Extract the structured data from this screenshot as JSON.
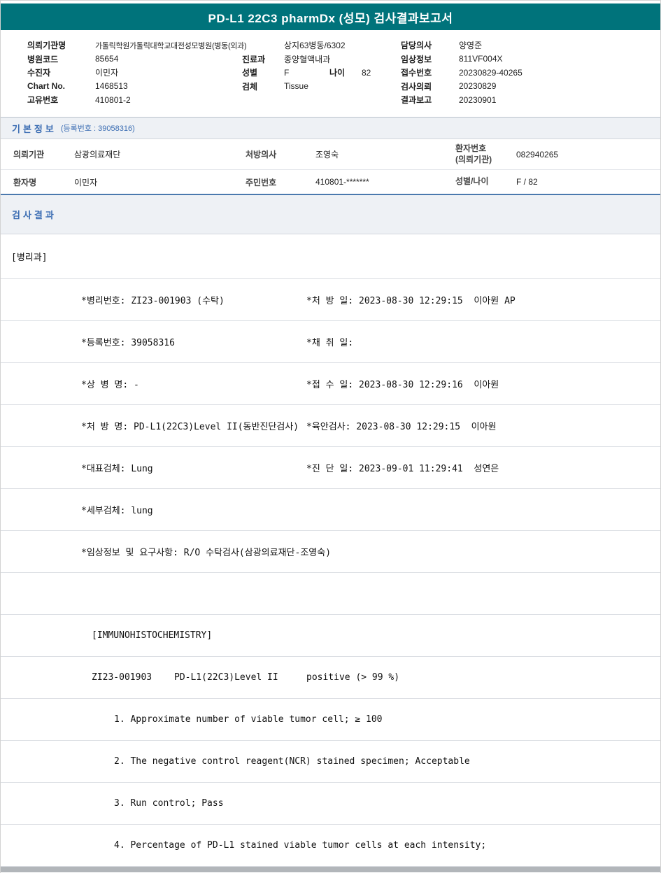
{
  "title": "PD-L1 22C3 pharmDx (성모) 검사결과보고서",
  "colors": {
    "header_teal": "#00737B",
    "section_blue": "#3B6DB3",
    "divider_blue": "#4B79AE"
  },
  "patient_header": {
    "rows": [
      {
        "a_label": "의뢰기관명",
        "a_value": "가톨릭학원가톨릭대학교대전성모병원(병동(외과)",
        "b_label": "",
        "b_value": "상지63병동/6302",
        "b2_label": "",
        "b2_value": "",
        "c_label": "담당의사",
        "c_value": "양영준"
      },
      {
        "a_label": "병원코드",
        "a_value": "85654",
        "b_label": "진료과",
        "b_value": "종양혈액내과",
        "b2_label": "",
        "b2_value": "",
        "c_label": "임상정보",
        "c_value": "811VF004X"
      },
      {
        "a_label": "수진자",
        "a_value": "이민자",
        "b_label": "성별",
        "b_value": "F",
        "b2_label": "나이",
        "b2_value": "82",
        "c_label": "접수번호",
        "c_value": "20230829-40265"
      },
      {
        "a_label": "Chart No.",
        "a_value": "1468513",
        "b_label": "검체",
        "b_value": "Tissue",
        "b2_label": "",
        "b2_value": "",
        "c_label": "검사의뢰",
        "c_value": "20230829"
      },
      {
        "a_label": "고유번호",
        "a_value": "410801-2",
        "b_label": "",
        "b_value": "",
        "b2_label": "",
        "b2_value": "",
        "c_label": "결과보고",
        "c_value": "20230901"
      }
    ]
  },
  "basic_info": {
    "title": "기본정보",
    "subtitle": "(등록번호 : 39058316)",
    "row1": {
      "l1": "의뢰기관",
      "v1": "삼광의료재단",
      "l2": "처방의사",
      "v2": "조영숙",
      "l3a": "환자번호",
      "l3b": "(의뢰기관)",
      "v3": "082940265"
    },
    "row2": {
      "l1": "환자명",
      "v1": "이민자",
      "l2": "주민번호",
      "v2": "410801-*******",
      "l3": "성별/나이",
      "v3": "F / 82"
    }
  },
  "results": {
    "title": "검사결과",
    "department": "[병리과]",
    "lines": [
      {
        "left": "*병리번호: ZI23-001903 (수탁)",
        "right": "*처 방 일: 2023-08-30 12:29:15  이아원 AP"
      },
      {
        "left": "*등록번호: 39058316",
        "right": "*채 취 일:"
      },
      {
        "left": "*상 병 명: -",
        "right": "*접 수 일: 2023-08-30 12:29:16  이아원"
      },
      {
        "left": "*처 방 명: PD-L1(22C3)Level II(동반진단검사)",
        "right": "*육안검사: 2023-08-30 12:29:15  이아원"
      },
      {
        "left": "*대표검체: Lung",
        "right": "*진 단 일: 2023-09-01 11:29:41  성연은"
      },
      {
        "left": "*세부검체: lung",
        "right": ""
      },
      {
        "left": "*임상정보 및 요구사항: R/O 수탁검사(삼광의료재단-조영숙)",
        "right": ""
      }
    ],
    "ihc_header": "[IMMUNOHISTOCHEMISTRY]",
    "ihc_row": {
      "code": "ZI23-001903",
      "test": "PD-L1(22C3)Level II",
      "value": "positive (> 99 %)"
    },
    "findings": [
      "1. Approximate number of viable tumor cell; ≥ 100",
      "2. The negative control reagent(NCR) stained specimen; Acceptable",
      "3. Run control; Pass",
      "4. Percentage of PD-L1 stained viable tumor cells at each intensity;"
    ]
  }
}
